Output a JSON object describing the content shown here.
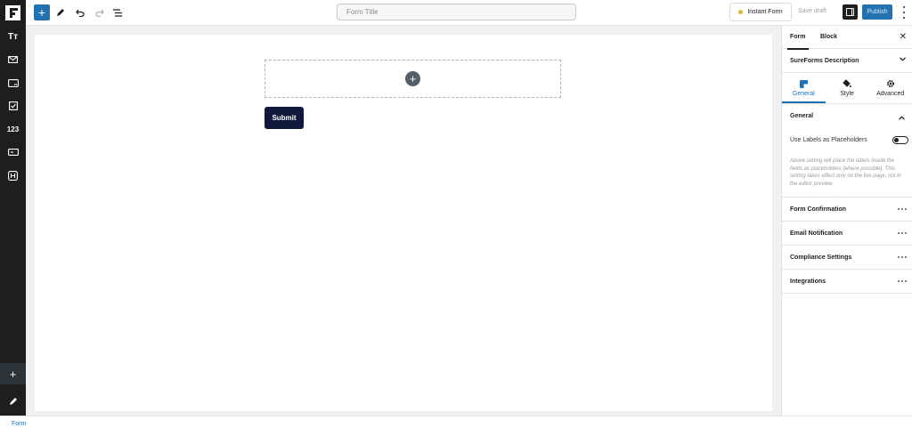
{
  "toolbar": {
    "add_label": "+",
    "title_placeholder": "Form Title",
    "instant_form_label": "Instant Form",
    "save_draft_label": "Save draft",
    "publish_label": "Publish",
    "accent_color": "#2271b1"
  },
  "left_sidebar": {
    "items": [
      {
        "icon": "text-icon",
        "glyph": "Tт"
      },
      {
        "icon": "email-icon",
        "glyph": ""
      },
      {
        "icon": "phone-icon",
        "glyph": ""
      },
      {
        "icon": "checkbox-icon",
        "glyph": ""
      },
      {
        "icon": "number-icon",
        "glyph": "123"
      },
      {
        "icon": "input-icon",
        "glyph": ""
      },
      {
        "icon": "heading-icon",
        "glyph": ""
      }
    ],
    "add_label": "+"
  },
  "canvas": {
    "submit_label": "Submit",
    "add_block_label": "+"
  },
  "right_panel": {
    "tabs": [
      "Form",
      "Block"
    ],
    "active_tab": "Form",
    "description_section": "SureForms Description",
    "subtabs": [
      "General",
      "Style",
      "Advanced"
    ],
    "active_subtab": "General",
    "general_heading": "General",
    "toggle_label": "Use Labels as Placeholders",
    "toggle_on": false,
    "help_text": "Above setting will place the labels inside the fields as placeholders (where possible). This setting takes effect only on the live page, not in the editor preview.",
    "sections": [
      "Form Confirmation",
      "Email Notification",
      "Compliance Settings",
      "Integrations"
    ]
  },
  "footer": {
    "breadcrumb": "Form"
  }
}
